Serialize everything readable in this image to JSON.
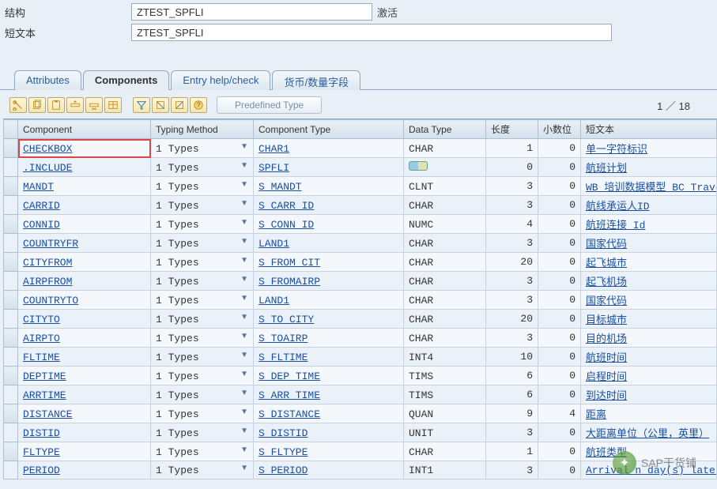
{
  "header": {
    "structure_label": "结构",
    "structure_value": "ZTEST_SPFLI",
    "activation_status": "激活",
    "short_text_label": "短文本",
    "short_text_value": "ZTEST_SPFLI"
  },
  "tabs": [
    {
      "label": "Attributes"
    },
    {
      "label": "Components"
    },
    {
      "label": "Entry help/check"
    },
    {
      "label": "货币/数量字段"
    }
  ],
  "active_tab": 1,
  "toolbar": {
    "predef_label": "Predefined Type",
    "counter": "1 ／ 18"
  },
  "columns": {
    "component": "Component",
    "typing_method": "Typing Method",
    "component_type": "Component Type",
    "data_type": "Data Type",
    "length": "长度",
    "decimals": "小数位",
    "short_desc": "短文本"
  },
  "rows": [
    {
      "component": "CHECKBOX",
      "tm_num": "1",
      "tm_txt": "Types",
      "ctype": "CHAR1",
      "dtype": "CHAR",
      "len": "1",
      "dec": "0",
      "desc": "单一字符标识",
      "include": false,
      "flat": false
    },
    {
      "component": ".INCLUDE",
      "tm_num": "1",
      "tm_txt": "Types",
      "ctype": "SPFLI",
      "dtype": "",
      "len": "0",
      "dec": "0",
      "desc": "航班计划",
      "include": true,
      "flat": true
    },
    {
      "component": "MANDT",
      "tm_num": "1",
      "tm_txt": "Types",
      "ctype": "S_MANDT",
      "dtype": "CLNT",
      "len": "3",
      "dec": "0",
      "desc": "WB 培训数据模型 BC_Travel 的",
      "include": true,
      "flat": false
    },
    {
      "component": "CARRID",
      "tm_num": "1",
      "tm_txt": "Types",
      "ctype": "S_CARR_ID",
      "dtype": "CHAR",
      "len": "3",
      "dec": "0",
      "desc": "航线承运人ID",
      "include": true,
      "flat": false
    },
    {
      "component": "CONNID",
      "tm_num": "1",
      "tm_txt": "Types",
      "ctype": "S_CONN_ID",
      "dtype": "NUMC",
      "len": "4",
      "dec": "0",
      "desc": "航班连接 Id",
      "include": true,
      "flat": false
    },
    {
      "component": "COUNTRYFR",
      "tm_num": "1",
      "tm_txt": "Types",
      "ctype": "LAND1",
      "dtype": "CHAR",
      "len": "3",
      "dec": "0",
      "desc": "国家代码",
      "include": true,
      "flat": false
    },
    {
      "component": "CITYFROM",
      "tm_num": "1",
      "tm_txt": "Types",
      "ctype": "S_FROM_CIT",
      "dtype": "CHAR",
      "len": "20",
      "dec": "0",
      "desc": "起飞城市",
      "include": true,
      "flat": false
    },
    {
      "component": "AIRPFROM",
      "tm_num": "1",
      "tm_txt": "Types",
      "ctype": "S_FROMAIRP",
      "dtype": "CHAR",
      "len": "3",
      "dec": "0",
      "desc": "起飞机场",
      "include": true,
      "flat": false
    },
    {
      "component": "COUNTRYTO",
      "tm_num": "1",
      "tm_txt": "Types",
      "ctype": "LAND1",
      "dtype": "CHAR",
      "len": "3",
      "dec": "0",
      "desc": "国家代码",
      "include": true,
      "flat": false
    },
    {
      "component": "CITYTO",
      "tm_num": "1",
      "tm_txt": "Types",
      "ctype": "S_TO_CITY",
      "dtype": "CHAR",
      "len": "20",
      "dec": "0",
      "desc": "目标城市",
      "include": true,
      "flat": false
    },
    {
      "component": "AIRPTO",
      "tm_num": "1",
      "tm_txt": "Types",
      "ctype": "S_TOAIRP",
      "dtype": "CHAR",
      "len": "3",
      "dec": "0",
      "desc": "目的机场",
      "include": true,
      "flat": false
    },
    {
      "component": "FLTIME",
      "tm_num": "1",
      "tm_txt": "Types",
      "ctype": "S_FLTIME",
      "dtype": "INT4",
      "len": "10",
      "dec": "0",
      "desc": "航班时间",
      "include": true,
      "flat": false
    },
    {
      "component": "DEPTIME",
      "tm_num": "1",
      "tm_txt": "Types",
      "ctype": "S_DEP_TIME",
      "dtype": "TIMS",
      "len": "6",
      "dec": "0",
      "desc": "启程时间",
      "include": true,
      "flat": false
    },
    {
      "component": "ARRTIME",
      "tm_num": "1",
      "tm_txt": "Types",
      "ctype": "S_ARR_TIME",
      "dtype": "TIMS",
      "len": "6",
      "dec": "0",
      "desc": "到达时间",
      "include": true,
      "flat": false
    },
    {
      "component": "DISTANCE",
      "tm_num": "1",
      "tm_txt": "Types",
      "ctype": "S_DISTANCE",
      "dtype": "QUAN",
      "len": "9",
      "dec": "4",
      "desc": "距离",
      "include": true,
      "flat": false
    },
    {
      "component": "DISTID",
      "tm_num": "1",
      "tm_txt": "Types",
      "ctype": "S_DISTID",
      "dtype": "UNIT",
      "len": "3",
      "dec": "0",
      "desc": "大距离单位（公里，英里）",
      "include": true,
      "flat": false
    },
    {
      "component": "FLTYPE",
      "tm_num": "1",
      "tm_txt": "Types",
      "ctype": "S_FLTYPE",
      "dtype": "CHAR",
      "len": "1",
      "dec": "0",
      "desc": "航班类型",
      "include": true,
      "flat": false
    },
    {
      "component": "PERIOD",
      "tm_num": "1",
      "tm_txt": "Types",
      "ctype": "S_PERIOD",
      "dtype": "INT1",
      "len": "3",
      "dec": "0",
      "desc": "Arrival n day(s) later",
      "include": true,
      "flat": false
    }
  ],
  "watermark": "SAP干货铺"
}
